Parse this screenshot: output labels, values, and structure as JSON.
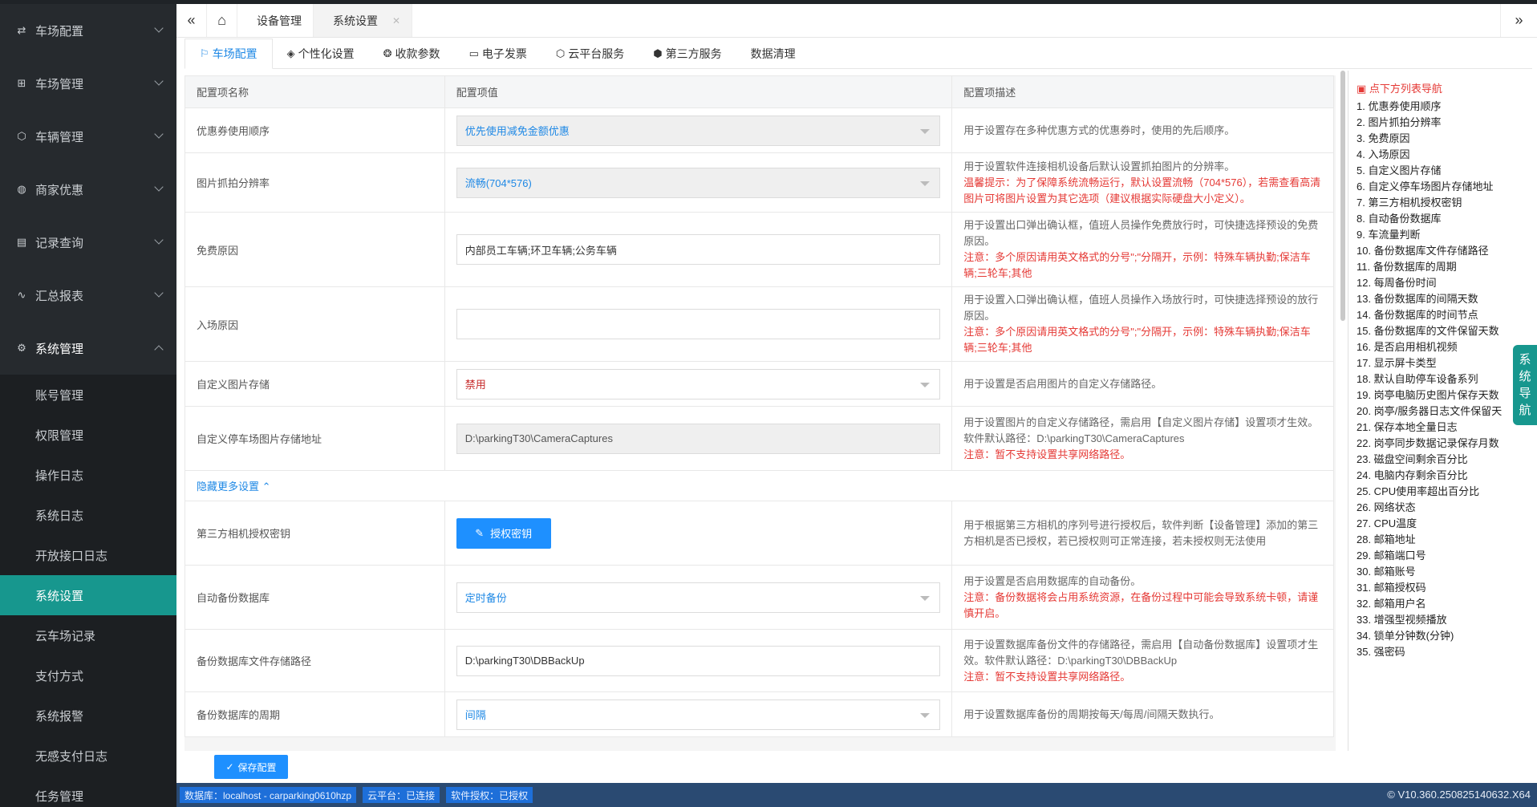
{
  "sidebar": {
    "groups_top": [
      {
        "icon": "⇄",
        "label": "车场配置"
      },
      {
        "icon": "⊞",
        "label": "车场管理"
      },
      {
        "icon": "⬡",
        "label": "车辆管理"
      },
      {
        "icon": "◍",
        "label": "商家优惠"
      },
      {
        "icon": "▤",
        "label": "记录查询"
      },
      {
        "icon": "∿",
        "label": "汇总报表"
      }
    ],
    "open_group": {
      "icon": "⚙",
      "label": "系统管理"
    },
    "sub_items": [
      "账号管理",
      "权限管理",
      "操作日志",
      "系统日志",
      "开放接口日志",
      "系统设置",
      "云车场记录",
      "支付方式",
      "系统报警",
      "无感支付日志",
      "任务管理"
    ]
  },
  "tabbar": {
    "collapse": "«",
    "home": "⌂",
    "tabs": [
      {
        "label": "设备管理"
      },
      {
        "label": "系统设置"
      }
    ],
    "close": "✕",
    "expand": "»"
  },
  "subtabs": [
    {
      "icon": "⚐",
      "label": "车场配置"
    },
    {
      "icon": "◈",
      "label": "个性化设置"
    },
    {
      "icon": "❂",
      "label": "收款参数"
    },
    {
      "icon": "▭",
      "label": "电子发票"
    },
    {
      "icon": "⬡",
      "label": "云平台服务"
    },
    {
      "icon": "⬢",
      "label": "第三方服务"
    },
    {
      "icon": "",
      "label": "数据清理"
    }
  ],
  "table": {
    "headers": [
      "配置项名称",
      "配置项值",
      "配置项描述"
    ],
    "rows": {
      "coupon": {
        "name": "优惠券使用顺序",
        "value": "优先使用减免金额优惠",
        "desc": "用于设置存在多种优惠方式的优惠券时，使用的先后顺序。"
      },
      "resolution": {
        "name": "图片抓拍分辨率",
        "value": "流畅(704*576)",
        "desc": "用于设置软件连接相机设备后默认设置抓拍图片的分辨率。",
        "warn": "温馨提示：为了保障系统流畅运行，默认设置流畅（704*576），若需查看高清图片可将图片设置为其它选项（建议根据实际硬盘大小定义）。"
      },
      "free_reason": {
        "name": "免费原因",
        "value": "内部员工车辆;环卫车辆;公务车辆",
        "desc": "用于设置出口弹出确认框，值班人员操作免费放行时，可快捷选择预设的免费原因。",
        "warn": "注意：多个原因请用英文格式的分号\";\"分隔开，示例：特殊车辆执勤;保洁车辆;三轮车;其他"
      },
      "entry_reason": {
        "name": "入场原因",
        "value": "",
        "desc": "用于设置入口弹出确认框，值班人员操作入场放行时，可快捷选择预设的放行原因。",
        "warn": "注意：多个原因请用英文格式的分号\";\"分隔开，示例：特殊车辆执勤;保洁车辆;三轮车;其他"
      },
      "custom_storage": {
        "name": "自定义图片存储",
        "value": "禁用",
        "desc": "用于设置是否启用图片的自定义存储路径。"
      },
      "storage_path": {
        "name": "自定义停车场图片存储地址",
        "value": "D:\\parkingT30\\CameraCaptures",
        "desc": "用于设置图片的自定义存储路径，需启用【自定义图片存储】设置项才生效。软件默认路径：D:\\parkingT30\\CameraCaptures",
        "warn": "注意：暂不支持设置共享网络路径。"
      },
      "toggle_more": {
        "label": "隐藏更多设置",
        "icon": "⌃"
      },
      "third_party": {
        "name": "第三方相机授权密钥",
        "button": "授权密钥",
        "button_icon": "✎",
        "desc": "用于根据第三方相机的序列号进行授权后，软件判断【设备管理】添加的第三方相机是否已授权，若已授权则可正常连接，若未授权则无法使用"
      },
      "auto_backup": {
        "name": "自动备份数据库",
        "value": "定时备份",
        "desc": "用于设置是否启用数据库的自动备份。",
        "warn": "注意：备份数据将会占用系统资源，在备份过程中可能会导致系统卡顿，请谨慎开启。"
      },
      "backup_path": {
        "name": "备份数据库文件存储路径",
        "value": "D:\\parkingT30\\DBBackUp",
        "desc": "用于设置数据库备份文件的存储路径，需启用【自动备份数据库】设置项才生效。软件默认路径：D:\\parkingT30\\DBBackUp",
        "warn": "注意：暂不支持设置共享网络路径。"
      },
      "backup_cycle": {
        "name": "备份数据库的周期",
        "value": "间隔",
        "desc": "用于设置数据库备份的周期按每天/每周/间隔天数执行。"
      }
    }
  },
  "save": {
    "icon": "✓",
    "label": "保存配置"
  },
  "status": {
    "badges": [
      "数据库：localhost - carparking0610hzp",
      "云平台：已连接",
      "软件授权：已授权"
    ],
    "version": "© V10.360.250825140632.X64"
  },
  "rightnav": {
    "title": "点下方列表导航",
    "title_icon": "▣",
    "items": [
      "1. 优惠券使用顺序",
      "2. 图片抓拍分辨率",
      "3. 免费原因",
      "4. 入场原因",
      "5. 自定义图片存储",
      "6. 自定义停车场图片存储地址",
      "7. 第三方相机授权密钥",
      "8. 自动备份数据库",
      "9. 车流量判断",
      "10. 备份数据库文件存储路径",
      "11. 备份数据库的周期",
      "12. 每周备份时间",
      "13. 备份数据库的间隔天数",
      "14. 备份数据库的时间节点",
      "15. 备份数据库的文件保留天数",
      "16. 是否启用相机视频",
      "17. 显示屏卡类型",
      "18. 默认自助停车设备系列",
      "19. 岗亭电脑历史图片保存天数",
      "20. 岗亭/服务器日志文件保留天",
      "21. 保存本地全量日志",
      "22. 岗亭同步数据记录保存月数",
      "23. 磁盘空间剩余百分比",
      "24. 电脑内存剩余百分比",
      "25. CPU使用率超出百分比",
      "26. 网络状态",
      "27. CPU温度",
      "28. 邮箱地址",
      "29. 邮箱端口号",
      "30. 邮箱账号",
      "31. 邮箱授权码",
      "32. 邮箱用户名",
      "33. 增强型视频播放",
      "34. 锁单分钟数(分钟)",
      "35. 强密码"
    ],
    "float_label": [
      "系",
      "统",
      "导",
      "航"
    ]
  }
}
